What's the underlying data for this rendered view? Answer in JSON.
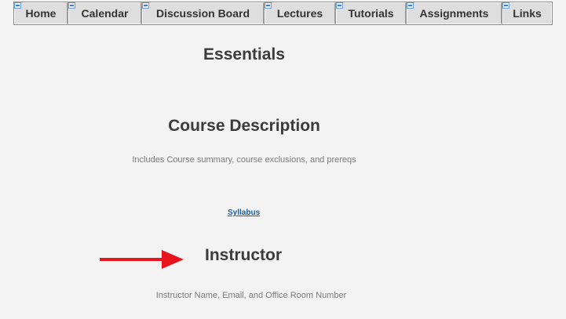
{
  "nav": {
    "items": [
      {
        "label": "Home",
        "icon": "broken-image-icon"
      },
      {
        "label": "Calendar",
        "icon": "broken-image-icon"
      },
      {
        "label": "Discussion Board",
        "icon": "broken-image-icon"
      },
      {
        "label": "Lectures",
        "icon": "broken-image-icon"
      },
      {
        "label": "Tutorials",
        "icon": "broken-image-icon"
      },
      {
        "label": "Assignments",
        "icon": "broken-image-icon"
      },
      {
        "label": "Links",
        "icon": "broken-image-icon"
      }
    ]
  },
  "main": {
    "essentials_title": "Essentials",
    "course_description": {
      "title": "Course Description",
      "text": "Includes Course summary, course exclusions, and prereqs",
      "link": "Syllabus"
    },
    "instructor": {
      "title": "Instructor",
      "text": "Instructor Name, Email, and Office Room Number"
    }
  },
  "colors": {
    "annotation_arrow": "#e8141c",
    "link": "#1a5fa8",
    "background": "#f3f3f3"
  }
}
